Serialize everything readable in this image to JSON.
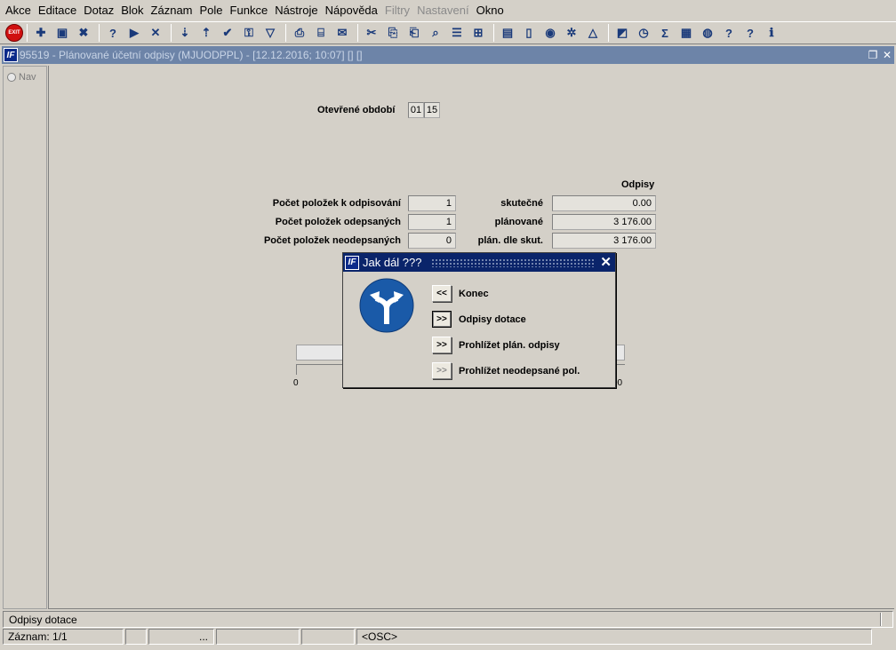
{
  "menu": {
    "items": [
      {
        "label": "Akce",
        "enabled": true
      },
      {
        "label": "Editace",
        "enabled": true
      },
      {
        "label": "Dotaz",
        "enabled": true
      },
      {
        "label": "Blok",
        "enabled": true
      },
      {
        "label": "Záznam",
        "enabled": true
      },
      {
        "label": "Pole",
        "enabled": true
      },
      {
        "label": "Funkce",
        "enabled": true
      },
      {
        "label": "Nástroje",
        "enabled": true
      },
      {
        "label": "Nápověda",
        "enabled": true
      },
      {
        "label": "Filtry",
        "enabled": false
      },
      {
        "label": "Nastavení",
        "enabled": false
      },
      {
        "label": "Okno",
        "enabled": true
      }
    ]
  },
  "toolbar": {
    "exit_label": "EXIT",
    "icons": [
      "exit-icon",
      "sep",
      "new-record-icon",
      "save-icon",
      "delete-record-icon",
      "sep",
      "query-icon",
      "run-query-icon",
      "cancel-query-icon",
      "sep",
      "sort-asc-icon",
      "sort-desc-icon",
      "accept-icon",
      "key-icon",
      "filter-icon",
      "sep",
      "print-icon",
      "print-preview-icon",
      "mail-icon",
      "sep",
      "cut-icon",
      "copy-icon",
      "paste-icon",
      "find-icon",
      "list-icon",
      "tree-icon",
      "sep",
      "document-icon",
      "page-icon",
      "globe-icon",
      "settings-icon",
      "warning-icon",
      "sep",
      "chart-icon",
      "calendar-icon",
      "sum-icon",
      "excel-icon",
      "browser-icon",
      "help-icon",
      "about-icon",
      "info-icon"
    ],
    "glyphs": {
      "new-record-icon": "✚",
      "save-icon": "▣",
      "delete-record-icon": "✖",
      "query-icon": "?",
      "run-query-icon": "▶",
      "cancel-query-icon": "✕",
      "sort-asc-icon": "⇣",
      "sort-desc-icon": "⇡",
      "accept-icon": "✔",
      "key-icon": "⚿",
      "filter-icon": "▽",
      "print-icon": "⎙",
      "print-preview-icon": "⌸",
      "mail-icon": "✉",
      "cut-icon": "✂",
      "copy-icon": "⎘",
      "paste-icon": "⎗",
      "find-icon": "⌕",
      "list-icon": "☰",
      "tree-icon": "⊞",
      "document-icon": "▤",
      "page-icon": "▯",
      "globe-icon": "◉",
      "settings-icon": "✲",
      "warning-icon": "△",
      "chart-icon": "◩",
      "calendar-icon": "◷",
      "sum-icon": "Σ",
      "excel-icon": "▦",
      "browser-icon": "◍",
      "help-icon": "?",
      "about-icon": "?",
      "info-icon": "ℹ"
    }
  },
  "window": {
    "logo": "IF",
    "title": "95519 - Plánované účetní odpisy (MJUODPPL) - [12.12.2016; 10:07] [] []"
  },
  "nav": {
    "label": "Nav"
  },
  "form": {
    "period_label": "Otevřené období",
    "period_month": "01",
    "period_year": "15",
    "odpisy_header": "Odpisy",
    "rows": [
      {
        "label": "Počet položek k odpisování",
        "count": "1",
        "kind": "skutečné",
        "amount": "0.00"
      },
      {
        "label": "Počet položek odepsaných",
        "count": "1",
        "kind": "plánované",
        "amount": "3 176.00"
      },
      {
        "label": "Počet položek neodepsaných",
        "count": "0",
        "kind": "plán. dle skut.",
        "amount": "3 176.00"
      }
    ],
    "progress": {
      "value": 0,
      "min_label": "0",
      "max_label": "00"
    }
  },
  "dialog": {
    "title": "Jak dál ???",
    "options": [
      {
        "button": "<<",
        "label": "Konec",
        "enabled": true,
        "focused": false
      },
      {
        "button": ">>",
        "label": "Odpisy dotace",
        "enabled": true,
        "focused": true
      },
      {
        "button": ">>",
        "label": "Prohlížet plán. odpisy",
        "enabled": true,
        "focused": false
      },
      {
        "button": ">>",
        "label": "Prohlížet neodepsané pol.",
        "enabled": false,
        "focused": false
      }
    ],
    "sign_color": "#1a5aa8"
  },
  "status": {
    "hint": "Odpisy dotace",
    "record": "Záznam: 1/1",
    "cell_dots": "...",
    "mode": "<OSC>"
  }
}
